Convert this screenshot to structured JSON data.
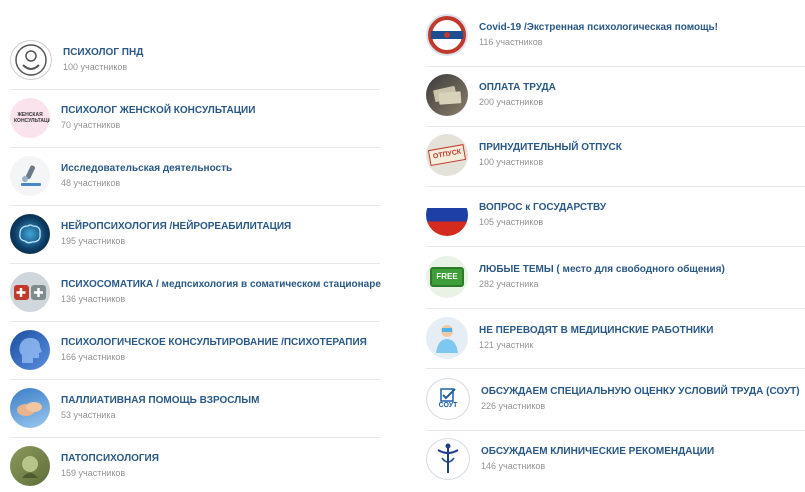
{
  "left_groups": [
    {
      "title": "ПСИХОЛОГ ПНД",
      "count": "100 участников",
      "icon": "psychologist-logo-icon"
    },
    {
      "title": "ПСИХОЛОГ ЖЕНСКОЙ КОНСУЛЬТАЦИИ",
      "count": "70 участников",
      "icon": "women-consultation-icon",
      "icon_text": "ЖЕНСКАЯ КОНСУЛЬТАЦИЯ"
    },
    {
      "title": "Исследовательская деятельность",
      "count": "48 участников",
      "icon": "microscope-icon"
    },
    {
      "title": "НЕЙРОПСИХОЛОГИЯ /НЕЙРОРЕАБИЛИТАЦИЯ",
      "count": "195 участников",
      "icon": "brain-icon"
    },
    {
      "title": "ПСИХОСОМАТИКА / медпсихология в соматическом стационаре",
      "count": "136 участников",
      "icon": "medical-puzzle-icon"
    },
    {
      "title": "ПСИХОЛОГИЧЕСКОЕ КОНСУЛЬТИРОВАНИЕ /ПСИХОТЕРАПИЯ",
      "count": "166 участников",
      "icon": "head-silhouette-icon"
    },
    {
      "title": "ПАЛЛИАТИВНАЯ ПОМОЩЬ ВЗРОСЛЫМ",
      "count": "53 участника",
      "icon": "helping-hands-icon"
    },
    {
      "title": "ПАТОПСИХОЛОГИЯ",
      "count": "159 участников",
      "icon": "pathopsychology-icon"
    }
  ],
  "right_groups": [
    {
      "title": "Covid-19 /Экстренная психологическая помощь!",
      "count": "116 участников",
      "icon": "emergency-help-badge-icon"
    },
    {
      "title": "ОПЛАТА ТРУДА",
      "count": "200 участников",
      "icon": "money-icon"
    },
    {
      "title": "ПРИНУДИТЕЛЬНЫЙ ОТПУСК",
      "count": "100 участников",
      "icon": "vacation-stamp-icon",
      "icon_text": "ОТПУСК"
    },
    {
      "title": "ВОПРОС к ГОСУДАРСТВУ",
      "count": "105 участников",
      "icon": "russian-flag-icon"
    },
    {
      "title": "ЛЮБЫЕ ТЕМЫ ( место для свободного общения)",
      "count": "282 участника",
      "icon": "free-sign-icon",
      "icon_text": "FREE"
    },
    {
      "title": "НЕ ПЕРЕВОДЯТ В МЕДИЦИНСКИЕ РАБОТНИКИ",
      "count": "121 участник",
      "icon": "medical-worker-icon"
    },
    {
      "title": "ОБСУЖДАЕМ СПЕЦИАЛЬНУЮ ОЦЕНКУ УСЛОВИЙ ТРУДА (СОУТ)",
      "count": "226 участников",
      "icon": "checklist-icon",
      "icon_text": "СОУТ"
    },
    {
      "title": "ОБСУЖДАЕМ КЛИНИЧЕСКИЕ РЕКОМЕНДАЦИИ",
      "count": "146 участников",
      "icon": "medical-caduceus-icon"
    }
  ],
  "colors": {
    "link": "#2a5885",
    "muted": "#939393",
    "separator": "#e7e8ec"
  }
}
